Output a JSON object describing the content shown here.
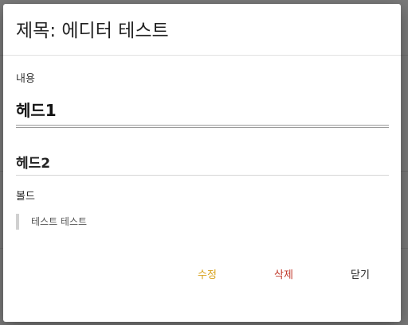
{
  "dialog": {
    "title": "제목: 에디터 테스트",
    "content_label": "내용",
    "content": {
      "heading1": "헤드1",
      "heading2": "헤드2",
      "bold": "볼드",
      "blockquote": "테스트 테스트"
    },
    "actions": {
      "edit_label": "수정",
      "delete_label": "삭제",
      "close_label": "닫기"
    }
  },
  "colors": {
    "edit": "#d8a21c",
    "delete": "#c0392b",
    "close": "#222222"
  }
}
